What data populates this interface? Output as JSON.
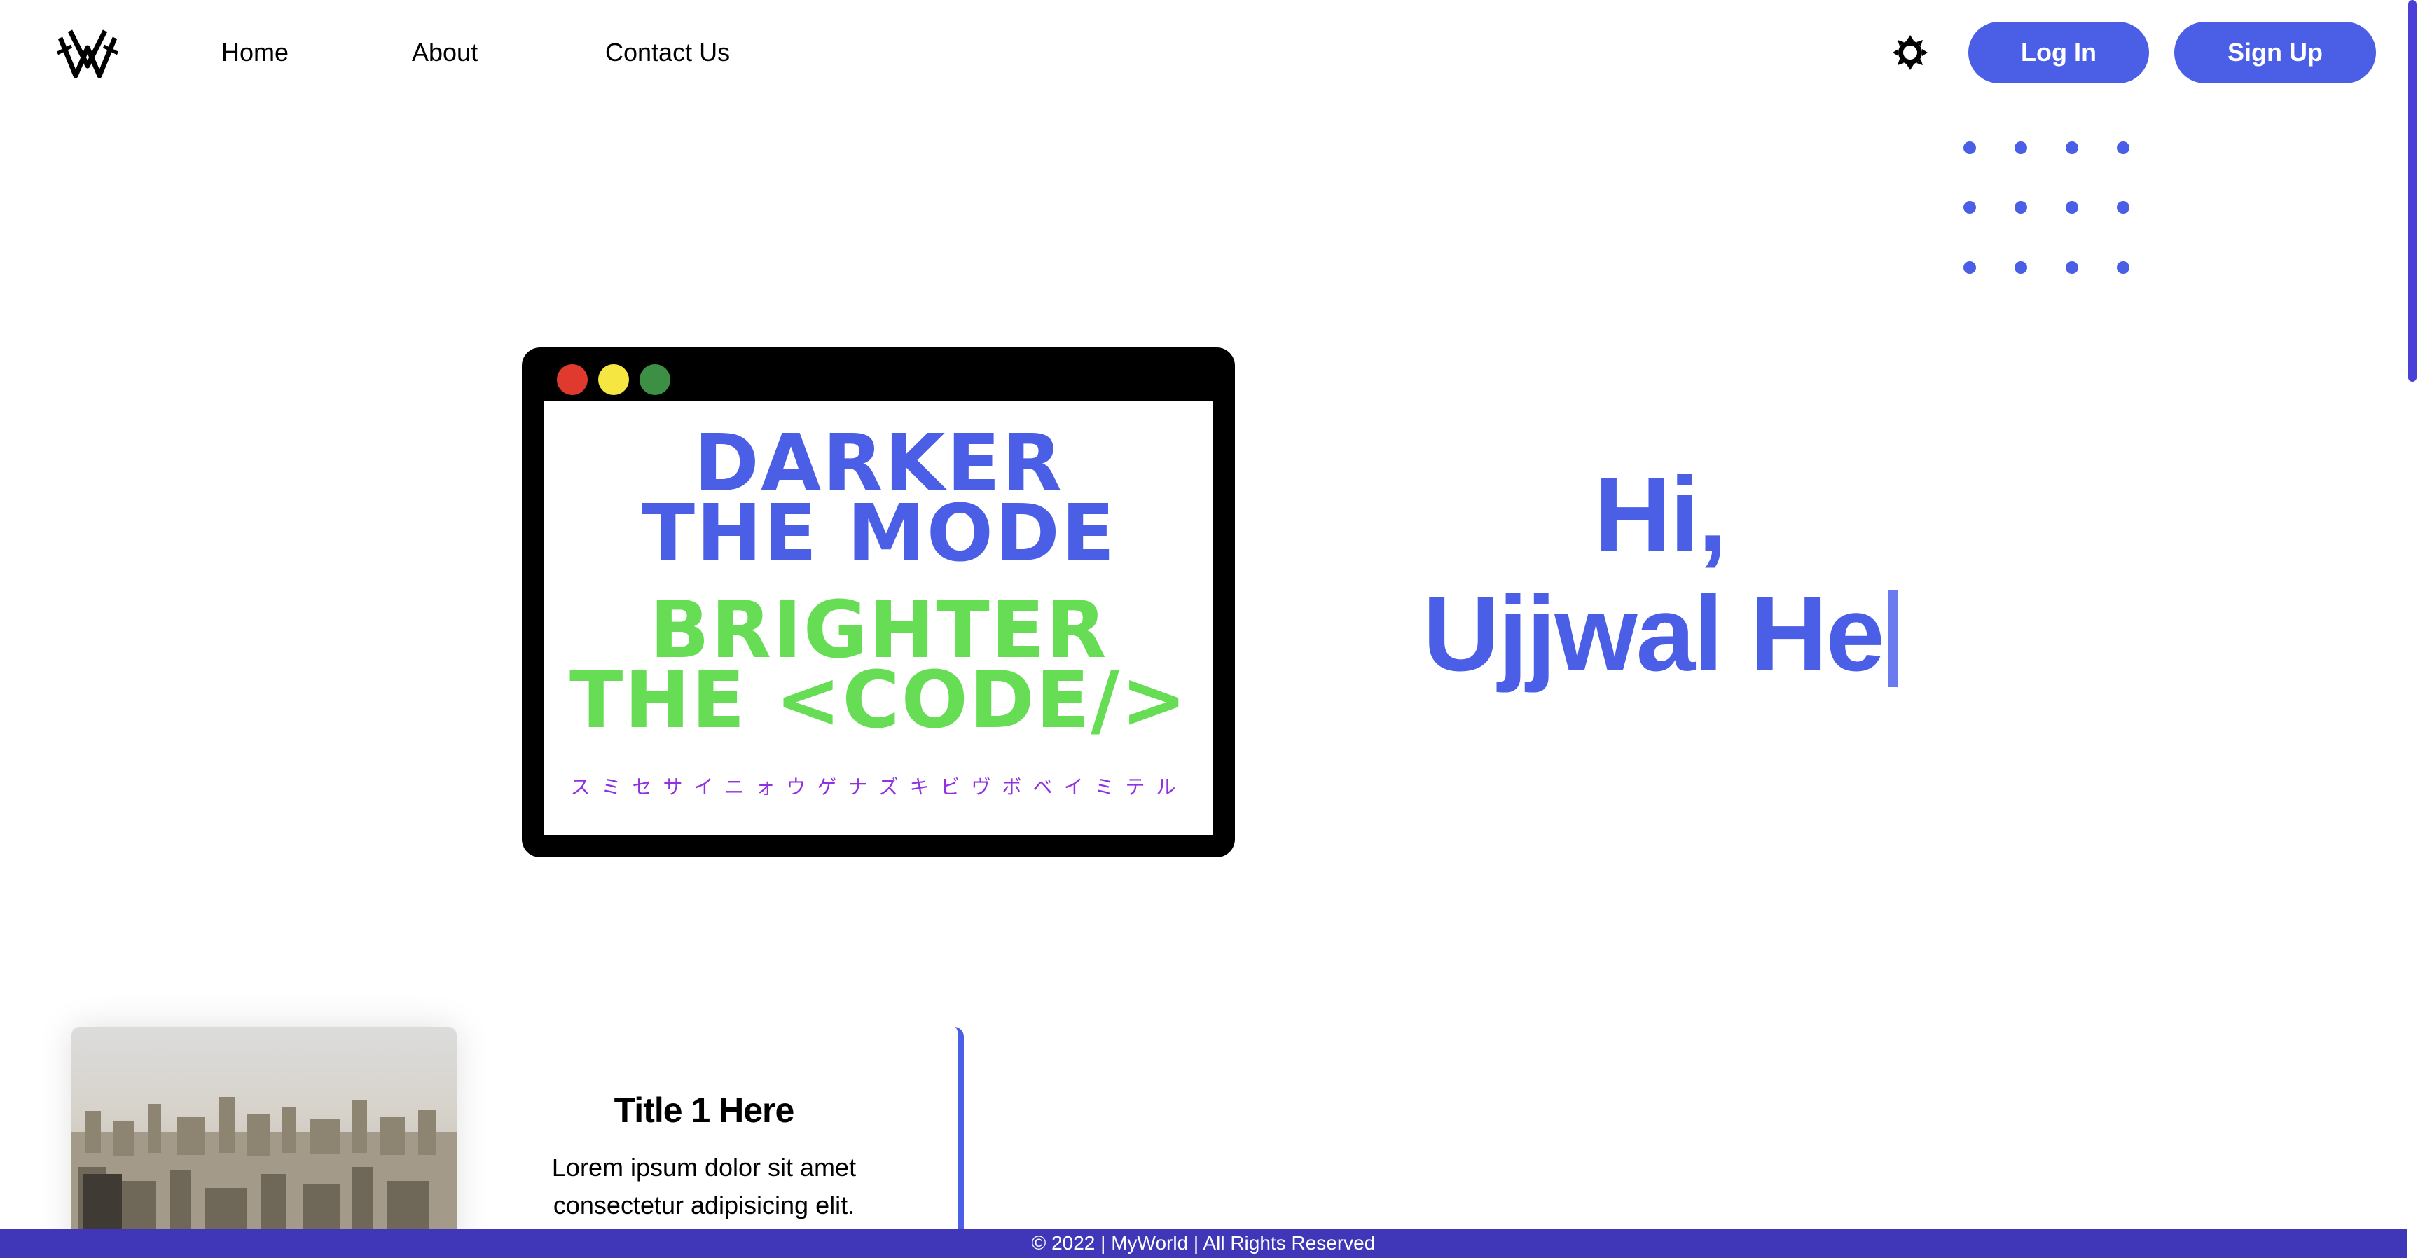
{
  "header": {
    "logo_icon": "brand-logo-icon",
    "nav": [
      {
        "label": "Home"
      },
      {
        "label": "About"
      },
      {
        "label": "Contact Us"
      }
    ],
    "theme_toggle_icon": "sun-gear-icon",
    "login_label": "Log In",
    "signup_label": "Sign Up"
  },
  "hero": {
    "window_buttons": [
      "close-dot",
      "minimize-dot",
      "maximize-dot"
    ],
    "slogan_line1": "Darker",
    "slogan_line2": "The Mode",
    "slogan_line3": "Brighter",
    "slogan_line4": "The <Code/>",
    "kana": "スミセサイニォウゲナズキビヴボベイミテル",
    "greeting_line1": "Hi,",
    "greeting_line2": "Ujjwal He"
  },
  "card": {
    "title": "Title 1 Here",
    "text": "Lorem ipsum dolor sit amet consectetur adipisicing elit."
  },
  "footer": {
    "text": "© 2022 | MyWorld | All Rights Reserved"
  },
  "colors": {
    "accent": "#4a5ee6",
    "green": "#66dd55",
    "purple": "#9030e0",
    "footer_bg": "#3f37b8",
    "close": "#e03a2e",
    "minimize": "#f5e642",
    "maximize": "#3c8f45"
  }
}
